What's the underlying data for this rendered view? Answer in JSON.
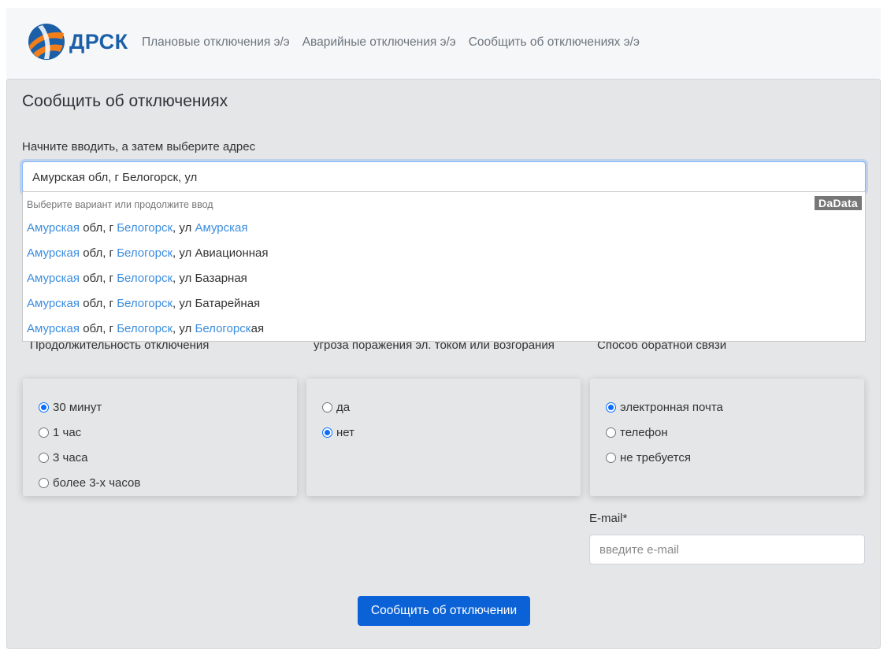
{
  "header": {
    "logo_text": "ДРСК",
    "nav": [
      {
        "label": "Плановые отключения э/э"
      },
      {
        "label": "Аварийные отключения э/э"
      },
      {
        "label": "Сообщить об отключениях э/э"
      }
    ]
  },
  "form": {
    "title": "Сообщить об отключениях",
    "address_label": "Начните вводить, а затем выберите адрес",
    "address_value": "Амурская обл, г Белогорск, ул",
    "suggestions": {
      "hint": "Выберите вариант или продолжите ввод",
      "brand": "DaData",
      "items": [
        {
          "a": "Амурская",
          "b": " обл, г ",
          "c": "Белогорск",
          "d": ", ул ",
          "e": "Амурская",
          "f": ""
        },
        {
          "a": "Амурская",
          "b": " обл, г ",
          "c": "Белогорск",
          "d": ", ул Авиационная",
          "e": "",
          "f": ""
        },
        {
          "a": "Амурская",
          "b": " обл, г ",
          "c": "Белогорск",
          "d": ", ул Базарная",
          "e": "",
          "f": ""
        },
        {
          "a": "Амурская",
          "b": " обл, г ",
          "c": "Белогорск",
          "d": ", ул Батарейная",
          "e": "",
          "f": ""
        },
        {
          "a": "Амурская",
          "b": " обл, г ",
          "c": "Белогорск",
          "d": ", ул ",
          "e": "Белогорск",
          "f": "ая"
        }
      ]
    },
    "duration": {
      "label": "Продолжительность отключения",
      "options": [
        {
          "label": "30 минут",
          "checked": true
        },
        {
          "label": "1 час",
          "checked": false
        },
        {
          "label": "3 часа",
          "checked": false
        },
        {
          "label": "более 3-х часов",
          "checked": false
        }
      ]
    },
    "danger": {
      "label": "угроза поражения эл. током или возгорания",
      "options": [
        {
          "label": "да",
          "checked": false
        },
        {
          "label": "нет",
          "checked": true
        }
      ]
    },
    "feedback": {
      "label": "Способ обратной связи",
      "options": [
        {
          "label": "электронная почта",
          "checked": true
        },
        {
          "label": "телефон",
          "checked": false
        },
        {
          "label": "не требуется",
          "checked": false
        }
      ]
    },
    "email_label": "E-mail*",
    "email_placeholder": "введите e-mail",
    "submit_label": "Сообщить об отключении"
  },
  "colors": {
    "accent": "#0d6efd",
    "highlight": "#3c8dde",
    "card_bg": "#e5e6e8"
  }
}
